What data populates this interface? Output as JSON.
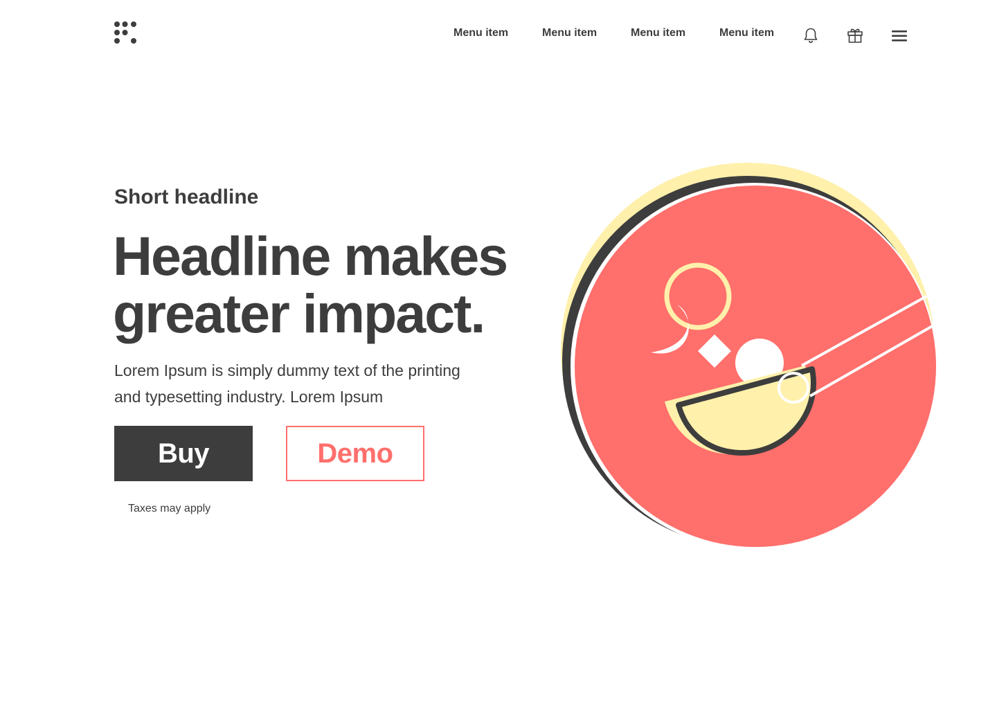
{
  "colors": {
    "text": "#3d3d3d",
    "accent": "#ff6f6c",
    "highlight": "#fff0ab",
    "background": "#ffffff"
  },
  "nav": {
    "logo_icon": "dot-grid-logo-icon",
    "menu_items": [
      {
        "label": "Menu item"
      },
      {
        "label": "Menu item"
      },
      {
        "label": "Menu item"
      },
      {
        "label": "Menu item"
      }
    ],
    "icons": [
      "bell-icon",
      "gift-icon",
      "hamburger-menu-icon"
    ]
  },
  "hero": {
    "eyebrow": "Short headline",
    "headline_lines": [
      "Headline makes",
      "greater impact."
    ],
    "body_lines": [
      "Lorem Ipsum is simply dummy text of the printing",
      "and typesetting industry. Lorem Ipsum"
    ],
    "buy_label": "Buy",
    "demo_label": "Demo",
    "fine_print": "Taxes may apply"
  }
}
